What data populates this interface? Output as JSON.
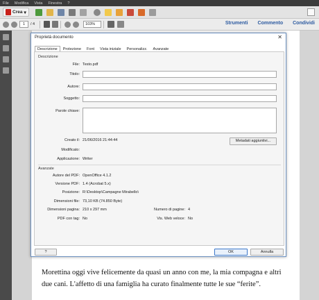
{
  "menu": [
    "File",
    "Modifica",
    "Vista",
    "Finestra",
    "?"
  ],
  "toolbar": {
    "create_label": "Crea",
    "create_caret": "▾"
  },
  "nav": {
    "page_current": "1",
    "page_total": "/ 4",
    "zoom": "103%"
  },
  "right_links": {
    "tools": "Strumenti",
    "comment": "Commento",
    "share": "Condividi"
  },
  "dialog": {
    "title": "Proprietà documento",
    "close": "✕",
    "tabs": [
      "Descrizione",
      "Protezione",
      "Font",
      "Vista iniziale",
      "Personalizz.",
      "Avanzate"
    ],
    "description": {
      "section_title": "Descrizione",
      "file_label": "File:",
      "file_value": "Testo.pdf",
      "title_label": "Titolo:",
      "author_label": "Autore:",
      "subject_label": "Soggetto:",
      "keywords_label": "Parole chiave:",
      "created_label": "Creato il:",
      "created_value": "21/06/2016 21:44:44",
      "modified_label": "Modificato:",
      "app_label": "Applicazione:",
      "app_value": "Writer",
      "metadata_button": "Metadati aggiuntivi..."
    },
    "advanced": {
      "section_title": "Avanzate",
      "pdf_author_label": "Autore del PDF:",
      "pdf_author_value": "OpenOffice 4.1.2",
      "pdf_version_label": "Versione PDF:",
      "pdf_version_value": "1.4 (Acrobat 5.x)",
      "location_label": "Posizione:",
      "location_value": "R:\\Desktop\\Campagne Mirabello\\",
      "filesize_label": "Dimensioni file:",
      "filesize_value": "73,10 KB (74.850 Byte)",
      "pagesize_label": "Dimensioni pagina:",
      "pagesize_value": "210 x 297 mm",
      "pagecount_label": "Numero di pagine:",
      "pagecount_value": "4",
      "tagged_label": "PDF con tag:",
      "tagged_value": "No",
      "fastweb_label": "Vis. Web veloce:",
      "fastweb_value": "No"
    },
    "help_button": "?",
    "ok_button": "OK",
    "cancel_button": "Annulla"
  },
  "page_text": "Morettina oggi vive felicemente da quasi un anno con me, la mia compagna e altri due cani. L'affetto di una famiglia ha curato finalmente tutte le sue “ferite”.",
  "colors": {
    "link_blue": "#2c5aa0",
    "menubar": "#3b3b3b",
    "accent_red": "#c8201a"
  }
}
